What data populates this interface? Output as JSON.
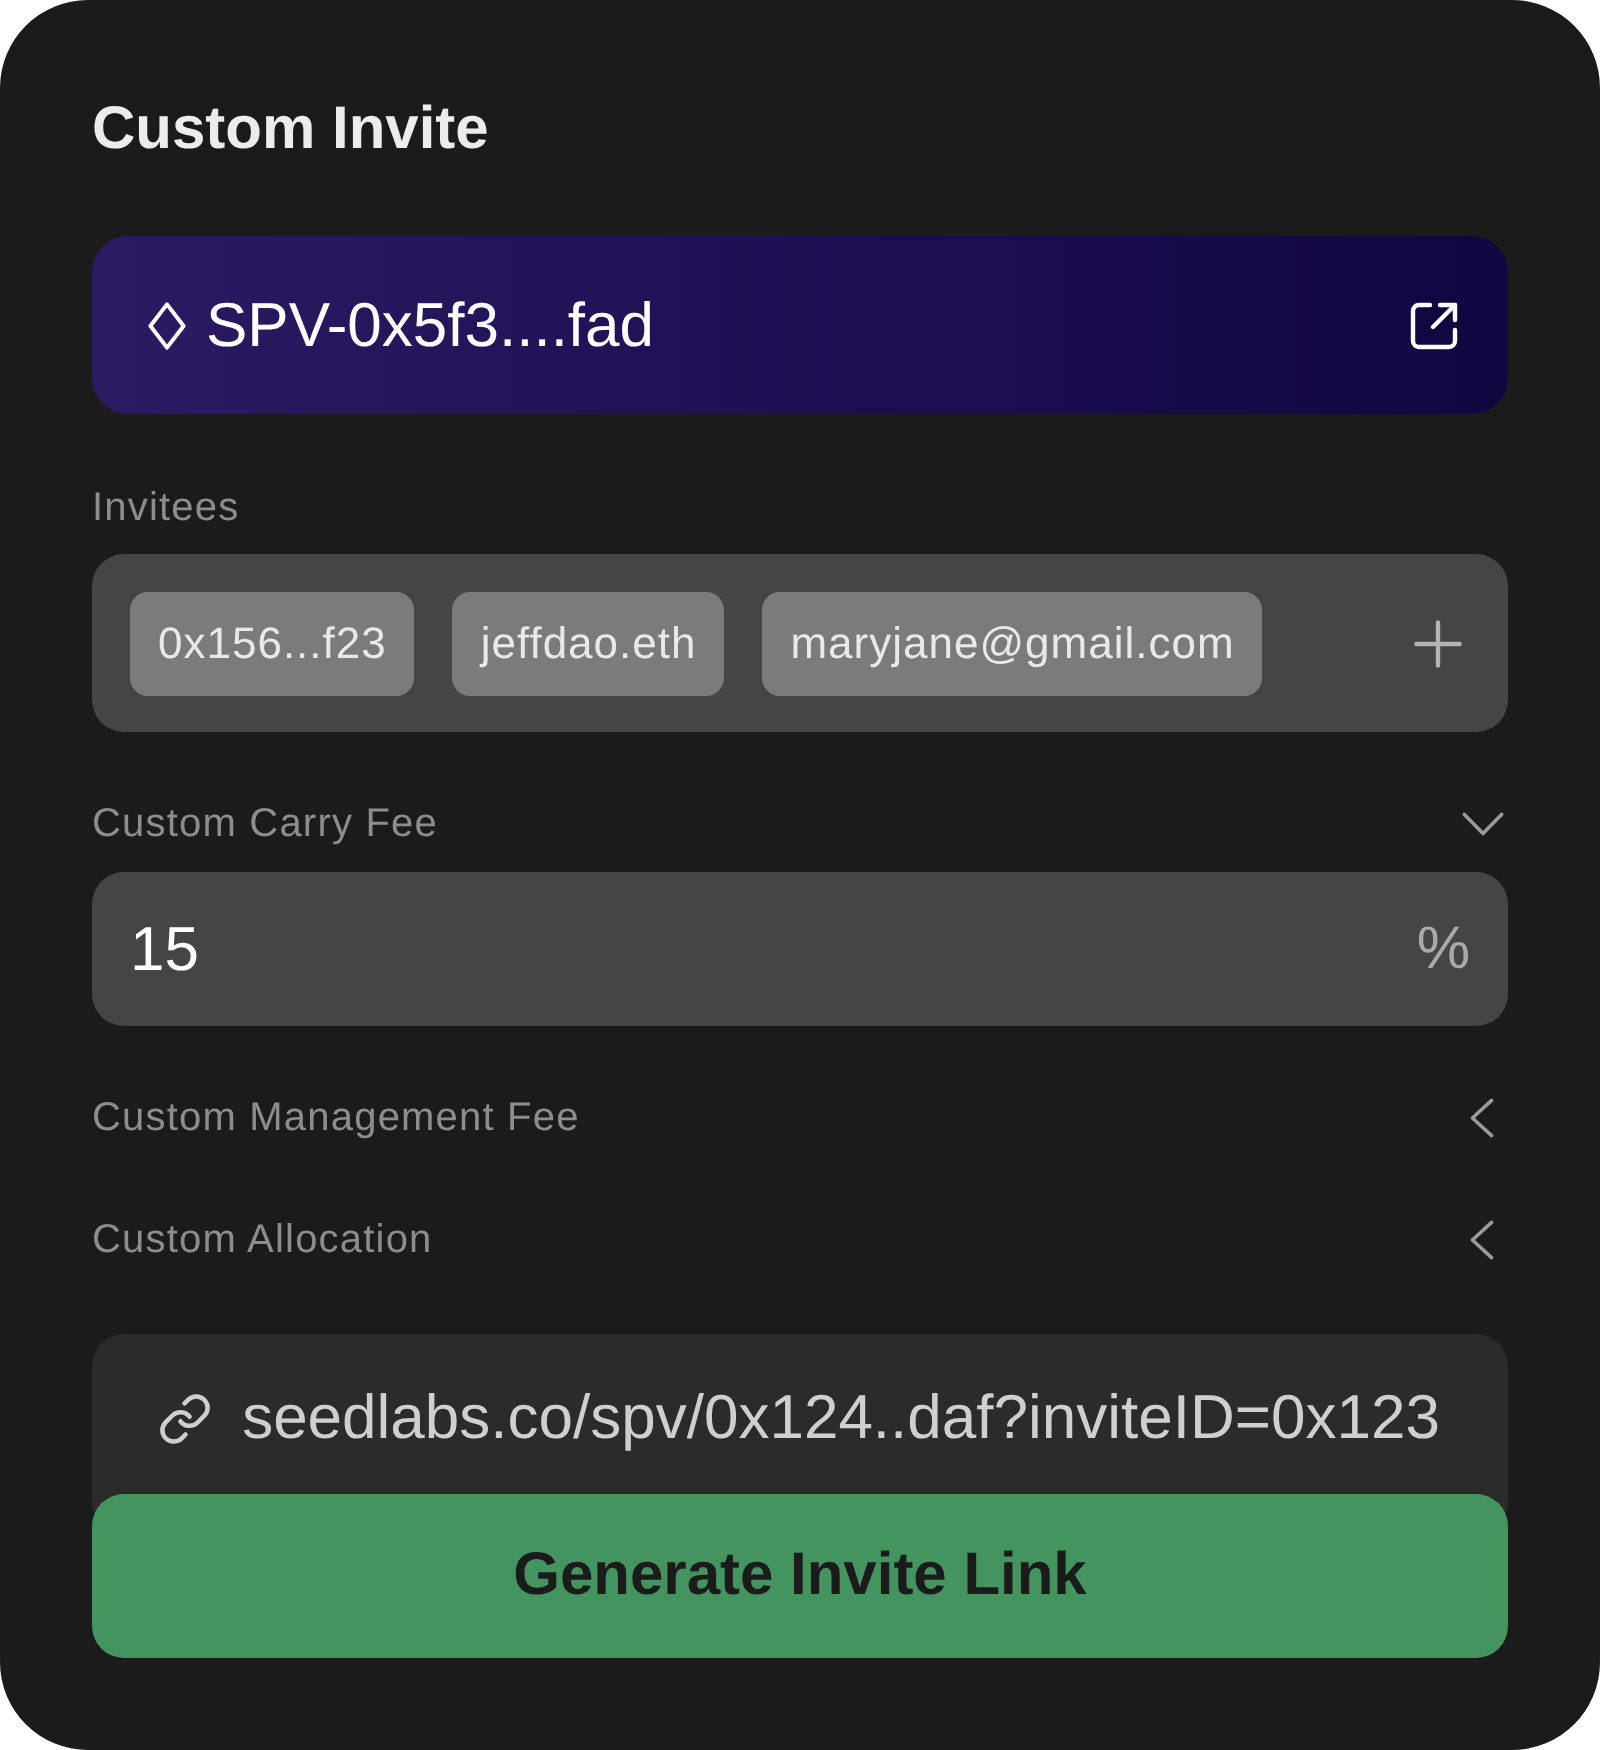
{
  "title": "Custom Invite",
  "spv": {
    "name": "SPV-0x5f3....fad"
  },
  "invitees": {
    "label": "Invitees",
    "items": [
      "0x156...f23",
      "jeffdao.eth",
      "maryjane@gmail.com"
    ]
  },
  "fees": [
    {
      "label": "Custom Carry Fee",
      "expanded": true,
      "value": "15",
      "unit": "%"
    },
    {
      "label": "Custom Management Fee",
      "expanded": false
    },
    {
      "label": "Custom Allocation",
      "expanded": false
    }
  ],
  "invite_link": {
    "url": "seedlabs.co/spv/0x124..daf?inviteID=0x123"
  },
  "generate_button": {
    "label": "Generate Invite Link"
  }
}
